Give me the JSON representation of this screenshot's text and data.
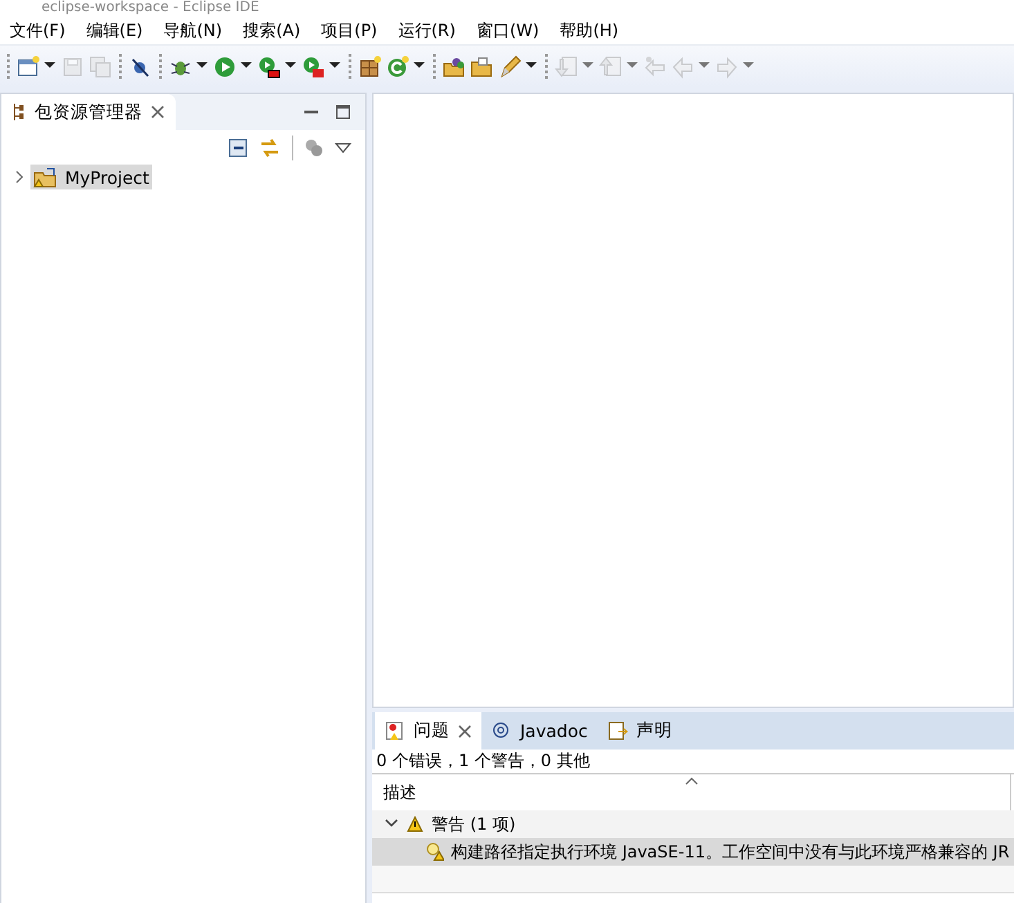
{
  "window": {
    "title": "eclipse-workspace - Eclipse IDE"
  },
  "menu": [
    "文件(F)",
    "编辑(E)",
    "导航(N)",
    "搜索(A)",
    "项目(P)",
    "运行(R)",
    "窗口(W)",
    "帮助(H)"
  ],
  "toolbar": [
    {
      "kind": "sep"
    },
    {
      "kind": "new",
      "disabled": false,
      "dropdown": true
    },
    {
      "kind": "save",
      "disabled": true,
      "dropdown": false
    },
    {
      "kind": "saveall",
      "disabled": true,
      "dropdown": false
    },
    {
      "kind": "sep"
    },
    {
      "kind": "skip",
      "disabled": false,
      "dropdown": false
    },
    {
      "kind": "sep"
    },
    {
      "kind": "bug",
      "disabled": false,
      "dropdown": true
    },
    {
      "kind": "run",
      "disabled": false,
      "dropdown": true
    },
    {
      "kind": "coverage",
      "disabled": false,
      "dropdown": true
    },
    {
      "kind": "external",
      "disabled": false,
      "dropdown": true
    },
    {
      "kind": "sep"
    },
    {
      "kind": "package",
      "disabled": false,
      "dropdown": false
    },
    {
      "kind": "newclass",
      "disabled": false,
      "dropdown": true
    },
    {
      "kind": "sep"
    },
    {
      "kind": "opentype",
      "disabled": false,
      "dropdown": false
    },
    {
      "kind": "folder",
      "disabled": false,
      "dropdown": false
    },
    {
      "kind": "pen",
      "disabled": false,
      "dropdown": true
    },
    {
      "kind": "sep"
    },
    {
      "kind": "next",
      "disabled": true,
      "dropdown": true
    },
    {
      "kind": "prev",
      "disabled": true,
      "dropdown": true
    },
    {
      "kind": "lastedit",
      "disabled": true,
      "dropdown": false
    },
    {
      "kind": "back",
      "disabled": true,
      "dropdown": true
    },
    {
      "kind": "forward",
      "disabled": true,
      "dropdown": true
    }
  ],
  "explorer": {
    "title": "包资源管理器",
    "items": [
      {
        "label": "MyProject",
        "selected": true,
        "expanded": false,
        "warning": true
      }
    ]
  },
  "problems": {
    "tabs": [
      {
        "label": "问题",
        "selected": true,
        "kind": "problems"
      },
      {
        "label": "Javadoc",
        "selected": false,
        "kind": "javadoc"
      },
      {
        "label": "声明",
        "selected": false,
        "kind": "declaration"
      }
    ],
    "summary": "0 个错误，1 个警告，0 其他",
    "column": "描述",
    "groups": [
      {
        "label": "警告 (1 项)",
        "expanded": true,
        "children": [
          {
            "label": "构建路径指定执行环境 JavaSE-11。工作空间中没有与此环境严格兼容的 JR",
            "selected": true
          }
        ]
      }
    ]
  }
}
